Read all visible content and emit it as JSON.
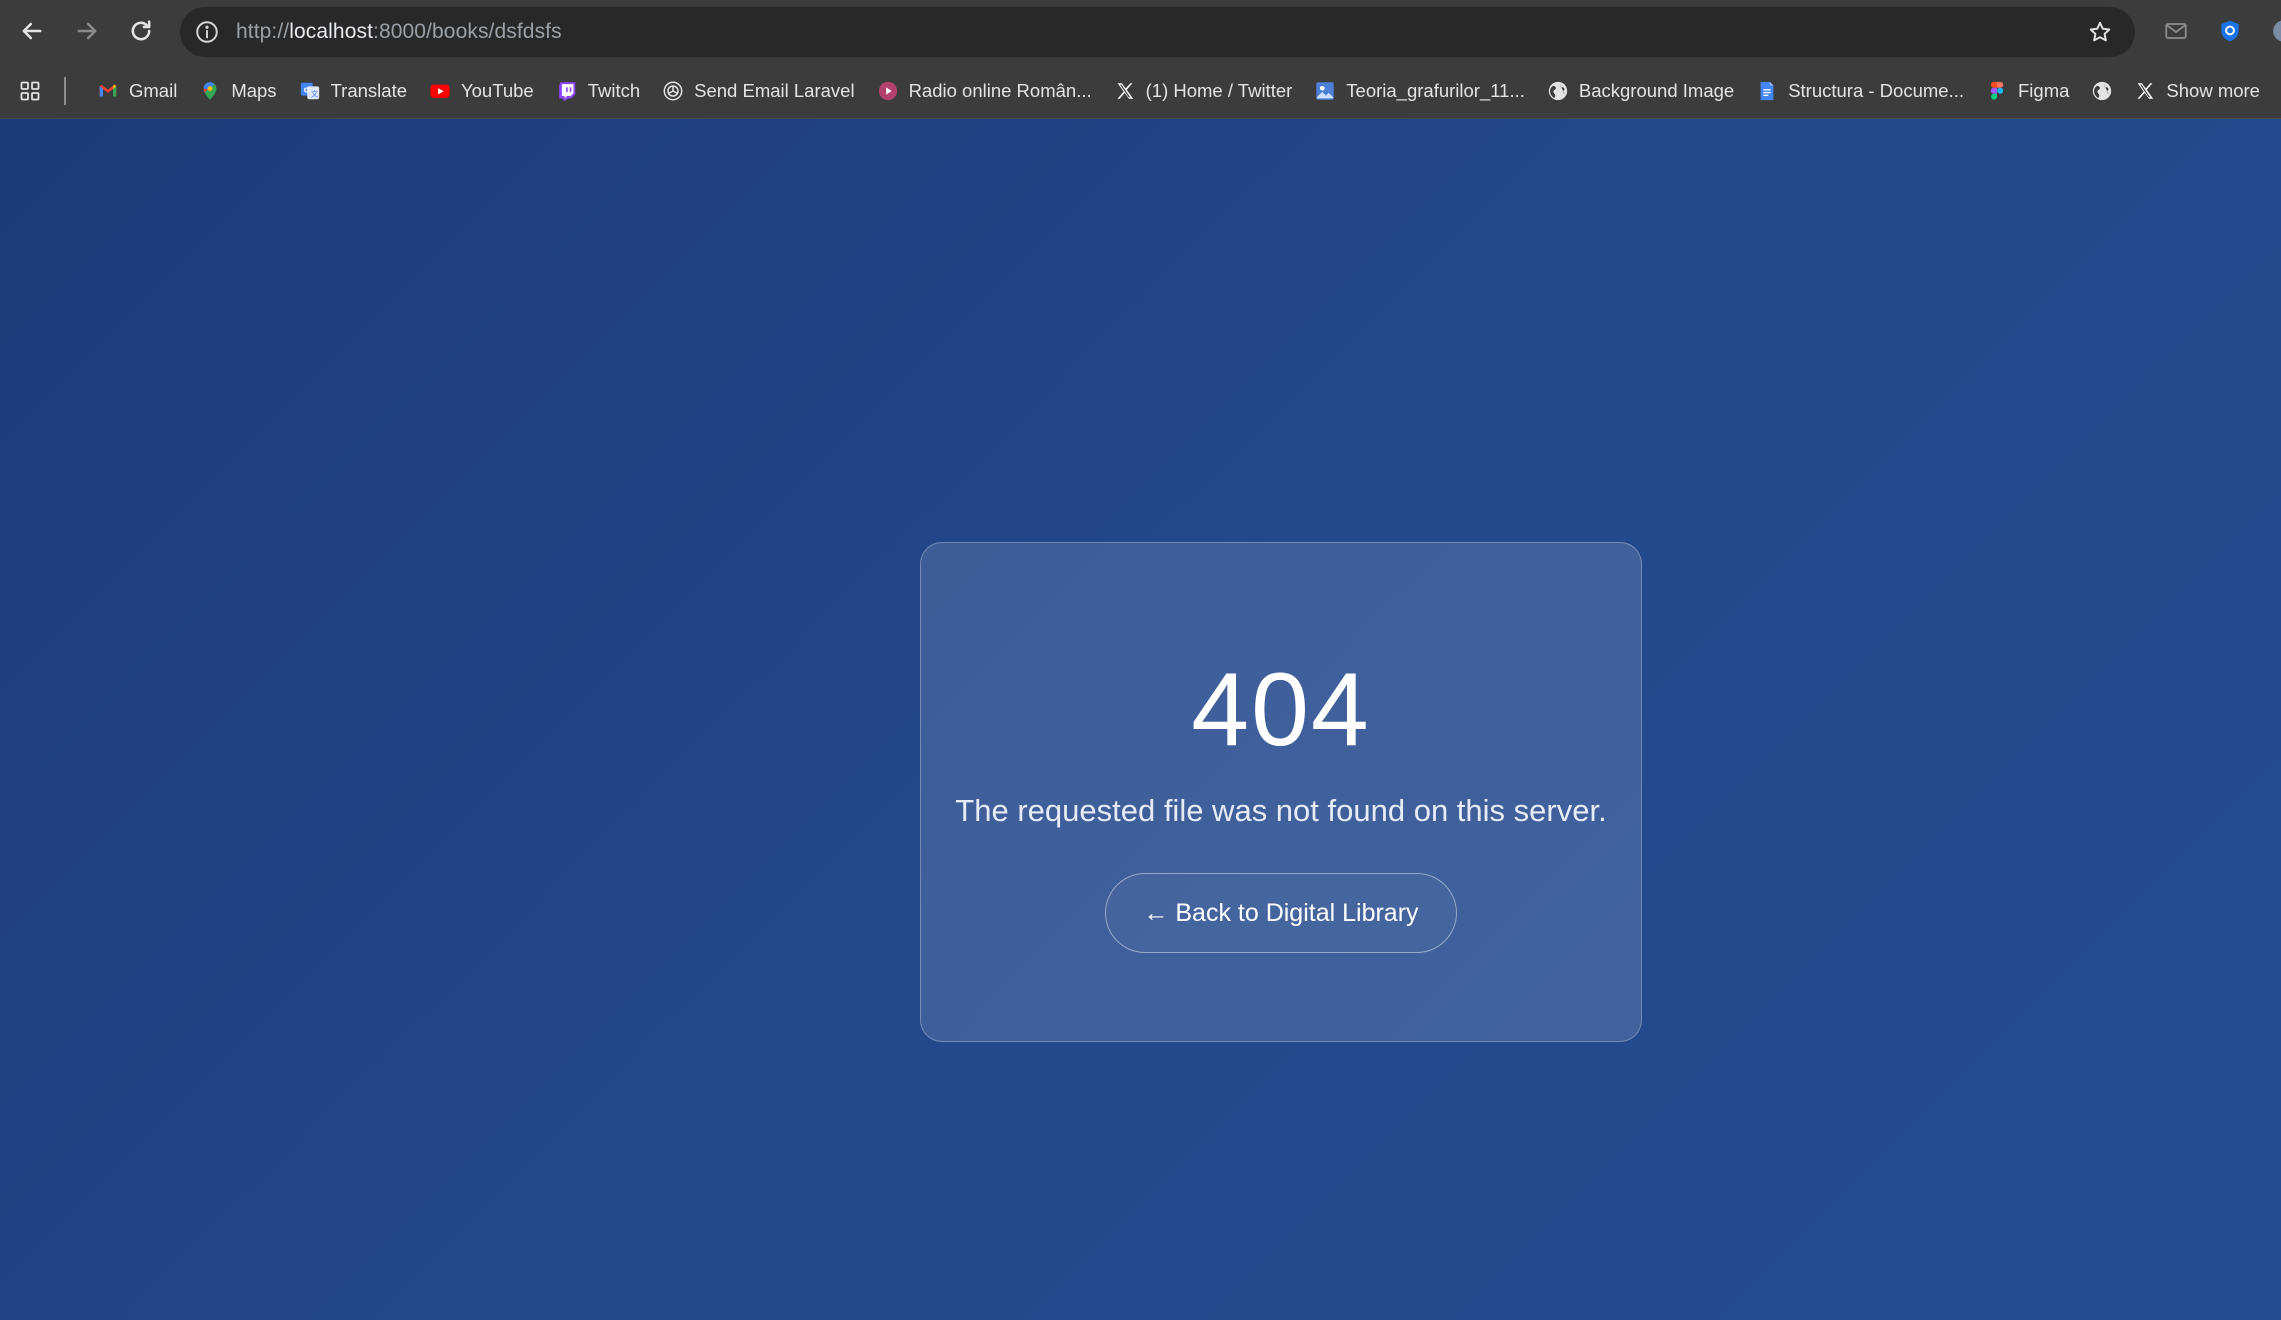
{
  "browser": {
    "url_scheme": "http://",
    "url_host": "localhost",
    "url_rest": ":8000/books/dsfdsfs"
  },
  "bookmarks": [
    {
      "label": "Gmail",
      "icon": "gmail-icon"
    },
    {
      "label": "Maps",
      "icon": "maps-icon"
    },
    {
      "label": "Translate",
      "icon": "translate-icon"
    },
    {
      "label": "YouTube",
      "icon": "youtube-icon"
    },
    {
      "label": "Twitch",
      "icon": "twitch-icon"
    },
    {
      "label": "Send Email Laravel",
      "icon": "openai-icon"
    },
    {
      "label": "Radio online Român...",
      "icon": "radio-icon"
    },
    {
      "label": "(1) Home / Twitter",
      "icon": "x-icon"
    },
    {
      "label": "Teoria_grafurilor_11...",
      "icon": "image-icon"
    },
    {
      "label": "Background Image",
      "icon": "globe-icon"
    },
    {
      "label": "Structura - Docume...",
      "icon": "docs-icon"
    },
    {
      "label": "Figma",
      "icon": "figma-icon"
    },
    {
      "label": "",
      "icon": "globe-icon"
    },
    {
      "label": "Show more",
      "icon": "x-icon"
    }
  ],
  "error": {
    "code": "404",
    "message": "The requested file was not found on this server.",
    "back_label": "← Back to Digital Library"
  },
  "colors": {
    "page_bg": "#23488c",
    "chrome_bg": "#3c3c3c"
  }
}
